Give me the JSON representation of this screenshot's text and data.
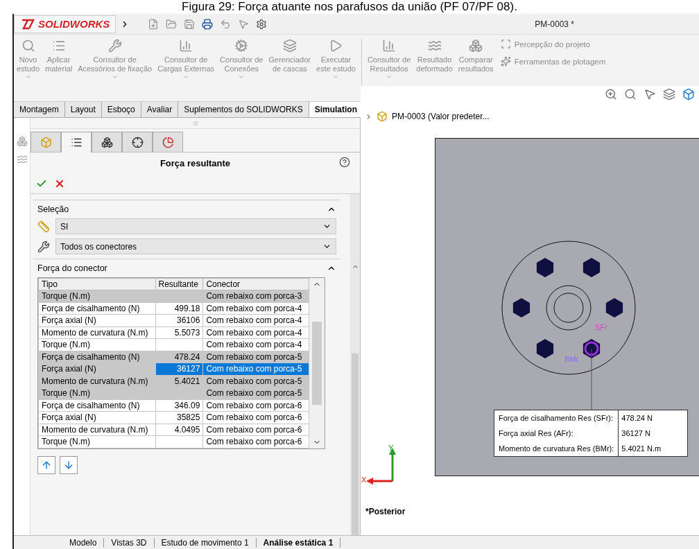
{
  "caption": "Figura 29: Força atuante nos parafusos da união (PF 07/PF 08).",
  "window": {
    "logo": "SOLIDWORKS",
    "title": "PM-0003 *"
  },
  "ribbon": {
    "commands": [
      {
        "label": "Novo\nestudo",
        "dropdown": true
      },
      {
        "label": "Aplicar\nmaterial",
        "dropdown": false
      },
      {
        "label": "Consultor de\nAcessórios de fixação",
        "dropdown": true
      },
      {
        "label": "Consultor de\nCargas Externas",
        "dropdown": true
      },
      {
        "label": "Consultor de\nConexões",
        "dropdown": true
      },
      {
        "label": "Gerenciador\nde cascas",
        "dropdown": false
      },
      {
        "label": "Executar\neste estudo",
        "dropdown": true
      },
      {
        "label": "Consultor de\nResultados",
        "dropdown": true
      },
      {
        "label": "Resultado\ndeformado",
        "dropdown": false
      },
      {
        "label": "Comparar\nresultados",
        "dropdown": false
      }
    ],
    "small_commands": [
      "Percepção do projeto",
      "Ferramentas de plotagem"
    ]
  },
  "tabs": [
    {
      "label": "Montagem",
      "selected": false
    },
    {
      "label": "Layout",
      "selected": false
    },
    {
      "label": "Esboço",
      "selected": false
    },
    {
      "label": "Avaliar",
      "selected": false
    },
    {
      "label": "Suplementos do SOLIDWORKS",
      "selected": false
    },
    {
      "label": "Simulation",
      "selected": true
    }
  ],
  "property_manager": {
    "tabs": [
      {
        "selected": false
      },
      {
        "selected": true
      },
      {
        "selected": false
      },
      {
        "selected": false
      },
      {
        "selected": false
      }
    ],
    "title": "Força resultante",
    "selection": {
      "heading": "Seleção",
      "units": "SI",
      "connectors": "Todos os conectores"
    },
    "connector_force": {
      "heading": "Força do conector",
      "columns": [
        "Tipo",
        "Resultante",
        "Conector"
      ],
      "rows": [
        {
          "tipo": "Torque (N.m)",
          "resultante": "",
          "conector": "Com rebaixo com porca-3",
          "highlighted": true,
          "selected": false
        },
        {
          "tipo": "Força de cisalhamento (N)",
          "resultante": "499.18",
          "conector": "Com rebaixo com porca-4",
          "highlighted": false,
          "selected": false
        },
        {
          "tipo": "Força axial (N)",
          "resultante": "36106",
          "conector": "Com rebaixo com porca-4",
          "highlighted": false,
          "selected": false
        },
        {
          "tipo": "Momento de curvatura (N.m)",
          "resultante": "5.5073",
          "conector": "Com rebaixo com porca-4",
          "highlighted": false,
          "selected": false
        },
        {
          "tipo": "Torque (N.m)",
          "resultante": "",
          "conector": "Com rebaixo com porca-4",
          "highlighted": false,
          "selected": false
        },
        {
          "tipo": "Força de cisalhamento (N)",
          "resultante": "478.24",
          "conector": "Com rebaixo com porca-5",
          "highlighted": true,
          "selected": false
        },
        {
          "tipo": "Força axial (N)",
          "resultante": "36127",
          "conector": "Com rebaixo com porca-5",
          "highlighted": true,
          "selected": true
        },
        {
          "tipo": "Momento de curvatura (N.m)",
          "resultante": "5.4021",
          "conector": "Com rebaixo com porca-5",
          "highlighted": true,
          "selected": false
        },
        {
          "tipo": "Torque (N.m)",
          "resultante": "",
          "conector": "Com rebaixo com porca-5",
          "highlighted": true,
          "selected": false
        },
        {
          "tipo": "Força de cisalhamento (N)",
          "resultante": "346.09",
          "conector": "Com rebaixo com porca-6",
          "highlighted": false,
          "selected": false
        },
        {
          "tipo": "Força axial (N)",
          "resultante": "35825",
          "conector": "Com rebaixo com porca-6",
          "highlighted": false,
          "selected": false
        },
        {
          "tipo": "Momento de curvatura (N.m)",
          "resultante": "4.0495",
          "conector": "Com rebaixo com porca-6",
          "highlighted": false,
          "selected": false
        },
        {
          "tipo": "Torque (N.m)",
          "resultante": "",
          "conector": "Com rebaixo com porca-6",
          "highlighted": false,
          "selected": false
        }
      ]
    }
  },
  "viewport": {
    "tree_item": "PM-0003  (Valor predeter...",
    "markers": [
      "SFr",
      "BMr"
    ],
    "callout": [
      {
        "label": "Forҫa de cisalhamento Res (SFr):",
        "value": "478.24 N"
      },
      {
        "label": "Forҫa axial Res (AFr):",
        "value": "36127 N"
      },
      {
        "label": "Momento de curvatura Res (BMr):",
        "value": "5.4021 N.m"
      }
    ],
    "axes": [
      "X",
      "Y"
    ],
    "view_name": "*Posterior"
  },
  "bottom_tabs": [
    {
      "label": "Modelo",
      "selected": false
    },
    {
      "label": "Vistas 3D",
      "selected": false
    },
    {
      "label": "Estudo de movimento 1",
      "selected": false
    },
    {
      "label": "Análise estática 1",
      "selected": true
    }
  ]
}
